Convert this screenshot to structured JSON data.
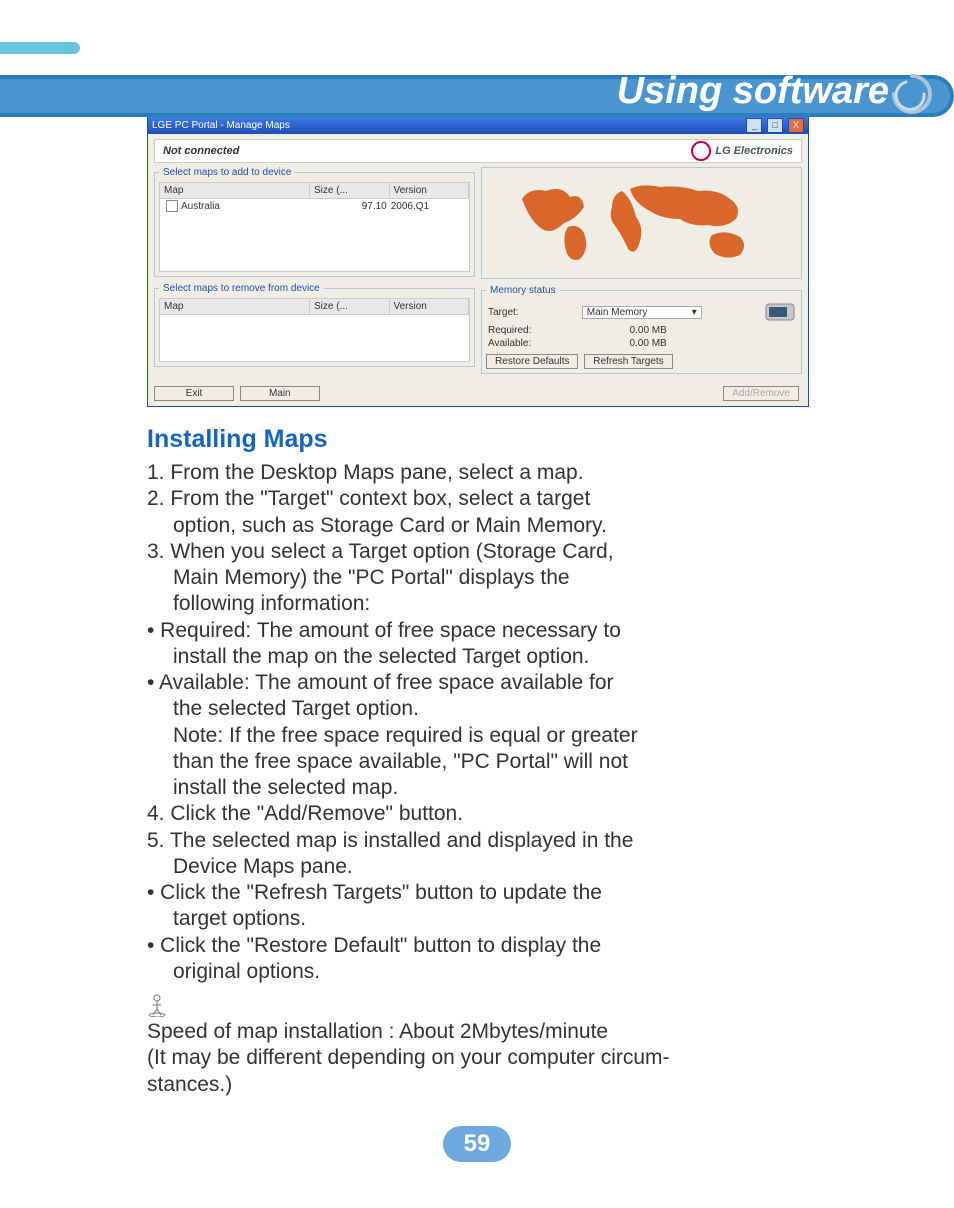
{
  "header": {
    "section_title": "Using software"
  },
  "screenshot": {
    "titlebar": "LGE PC Portal - Manage Maps",
    "sysbuttons": {
      "min": "_",
      "max": "□",
      "close": "X"
    },
    "status_left": "Not connected",
    "status_right": "LG Electronics",
    "add_legend": "Select maps to add to device",
    "remove_legend": "Select maps to remove from device",
    "table_headers": {
      "map": "Map",
      "size": "Size (...",
      "version": "Version"
    },
    "add_rows": [
      {
        "map": "Australia",
        "size": "97.10",
        "version": "2006.Q1"
      }
    ],
    "memory_legend": "Memory status",
    "memory": {
      "target_label": "Target:",
      "target_value": "Main Memory",
      "required_label": "Required:",
      "required_value": "0.00  MB",
      "available_label": "Available:",
      "available_value": "0.00  MB"
    },
    "buttons": {
      "restore": "Restore Defaults",
      "refresh": "Refresh Targets",
      "exit": "Exit",
      "main": "Main",
      "addremove": "Add/Remove"
    }
  },
  "article": {
    "heading": "Installing Maps",
    "lines": [
      {
        "text": "1. From the Desktop Maps pane, select a map.",
        "indent": false
      },
      {
        "text": "2. From the \"Target\" context box, select a target",
        "indent": false
      },
      {
        "text": "option, such as Storage Card or Main Memory.",
        "indent": true
      },
      {
        "text": "3. When you select a Target option (Storage Card,",
        "indent": false
      },
      {
        "text": "Main Memory) the \"PC Portal\" displays the",
        "indent": true
      },
      {
        "text": "following information:",
        "indent": true
      },
      {
        "text": "• Required: The amount of free space necessary to",
        "indent": false
      },
      {
        "text": "install the map on the selected Target option.",
        "indent": true
      },
      {
        "text": "• Available: The amount of free space available for",
        "indent": false
      },
      {
        "text": "the selected Target option.",
        "indent": true
      },
      {
        "text": "Note: If the free space required is equal or greater",
        "indent": true
      },
      {
        "text": "than the free space available, \"PC Portal\" will not",
        "indent": true
      },
      {
        "text": "install the selected map.",
        "indent": true
      },
      {
        "text": "4. Click the \"Add/Remove\" button.",
        "indent": false
      },
      {
        "text": "5. The selected map is installed and displayed in the",
        "indent": false
      },
      {
        "text": "Device Maps pane.",
        "indent": true
      },
      {
        "text": "• Click the \"Refresh Targets\" button to update the",
        "indent": false
      },
      {
        "text": "target options.",
        "indent": true
      },
      {
        "text": "• Click the \"Restore Default\" button to display the",
        "indent": false
      },
      {
        "text": "original options.",
        "indent": true
      }
    ],
    "note1": "Speed of map installation : About 2Mbytes/minute",
    "note2": "(It may be different depending on your computer circum-",
    "note3": "stances.)"
  },
  "page_number": "59"
}
